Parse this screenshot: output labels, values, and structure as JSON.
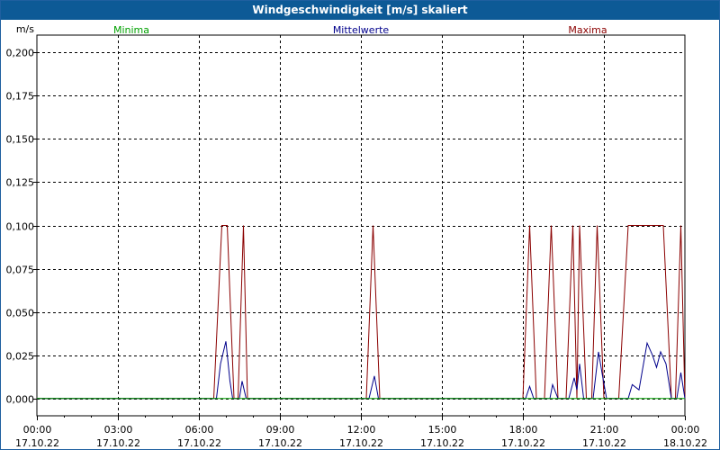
{
  "window": {
    "title": "Windgeschwindigkeit [m/s] skaliert"
  },
  "colors": {
    "min": "#00a000",
    "mean": "#00008b",
    "max": "#8b0000",
    "grid": "#000000",
    "titlebar": "#0d5a96"
  },
  "chart_data": {
    "type": "line",
    "title": "Windgeschwindigkeit [m/s] skaliert",
    "ylabel": "m/s",
    "ylim": [
      -0.01,
      0.21
    ],
    "yticks": [
      0.0,
      0.025,
      0.05,
      0.075,
      0.1,
      0.125,
      0.15,
      0.175,
      0.2
    ],
    "ytick_labels": [
      "0,000",
      "0,025",
      "0,050",
      "0,075",
      "0,100",
      "0,125",
      "0,150",
      "0,175",
      "0,200"
    ],
    "xlim_hours": [
      0,
      24
    ],
    "xticks_hours": [
      0,
      3,
      6,
      9,
      12,
      15,
      18,
      21,
      24
    ],
    "xtick_times": [
      "00:00",
      "03:00",
      "06:00",
      "09:00",
      "12:00",
      "15:00",
      "18:00",
      "21:00",
      "00:00"
    ],
    "xtick_dates": [
      "17.10.22",
      "17.10.22",
      "17.10.22",
      "17.10.22",
      "17.10.22",
      "17.10.22",
      "17.10.22",
      "17.10.22",
      "18.10.22"
    ],
    "grid": true,
    "series": [
      {
        "name": "Minima",
        "color": "#00a000",
        "points": [
          [
            0,
            0
          ],
          [
            24,
            0
          ]
        ]
      },
      {
        "name": "Mittelwerte",
        "color": "#00008b",
        "points": [
          [
            0,
            0
          ],
          [
            6.65,
            0
          ],
          [
            6.8,
            0.02
          ],
          [
            7.0,
            0.033
          ],
          [
            7.15,
            0.01
          ],
          [
            7.25,
            0
          ],
          [
            7.5,
            0
          ],
          [
            7.6,
            0.01
          ],
          [
            7.75,
            0
          ],
          [
            12.3,
            0
          ],
          [
            12.5,
            0.013
          ],
          [
            12.65,
            0
          ],
          [
            18.1,
            0
          ],
          [
            18.25,
            0.007
          ],
          [
            18.4,
            0
          ],
          [
            19.0,
            0
          ],
          [
            19.1,
            0.008
          ],
          [
            19.3,
            0
          ],
          [
            19.7,
            0
          ],
          [
            19.9,
            0.012
          ],
          [
            20.0,
            0.005
          ],
          [
            20.1,
            0.02
          ],
          [
            20.25,
            0
          ],
          [
            20.6,
            0
          ],
          [
            20.8,
            0.027
          ],
          [
            20.95,
            0.013
          ],
          [
            21.1,
            0
          ],
          [
            21.9,
            0
          ],
          [
            22.05,
            0.008
          ],
          [
            22.3,
            0.005
          ],
          [
            22.6,
            0.032
          ],
          [
            22.8,
            0.025
          ],
          [
            22.95,
            0.018
          ],
          [
            23.1,
            0.027
          ],
          [
            23.3,
            0.02
          ],
          [
            23.5,
            0
          ],
          [
            23.7,
            0
          ],
          [
            23.85,
            0.015
          ],
          [
            24.0,
            0
          ]
        ]
      },
      {
        "name": "Maxima",
        "color": "#8b0000",
        "points": [
          [
            0,
            0
          ],
          [
            6.55,
            0
          ],
          [
            6.85,
            0.1
          ],
          [
            7.05,
            0.1
          ],
          [
            7.3,
            0
          ],
          [
            7.45,
            0
          ],
          [
            7.65,
            0.1
          ],
          [
            7.8,
            0
          ],
          [
            12.2,
            0
          ],
          [
            12.45,
            0.1
          ],
          [
            12.7,
            0
          ],
          [
            18.0,
            0
          ],
          [
            18.25,
            0.1
          ],
          [
            18.5,
            0
          ],
          [
            18.8,
            0
          ],
          [
            19.05,
            0.1
          ],
          [
            19.3,
            0
          ],
          [
            19.6,
            0
          ],
          [
            19.85,
            0.1
          ],
          [
            20.0,
            0
          ],
          [
            20.1,
            0.1
          ],
          [
            20.35,
            0
          ],
          [
            20.55,
            0
          ],
          [
            20.75,
            0.1
          ],
          [
            21.0,
            0
          ],
          [
            21.55,
            0
          ],
          [
            21.9,
            0.1
          ],
          [
            23.2,
            0.1
          ],
          [
            23.5,
            0
          ],
          [
            23.65,
            0
          ],
          [
            23.85,
            0.1
          ],
          [
            24.0,
            0
          ]
        ]
      }
    ]
  }
}
